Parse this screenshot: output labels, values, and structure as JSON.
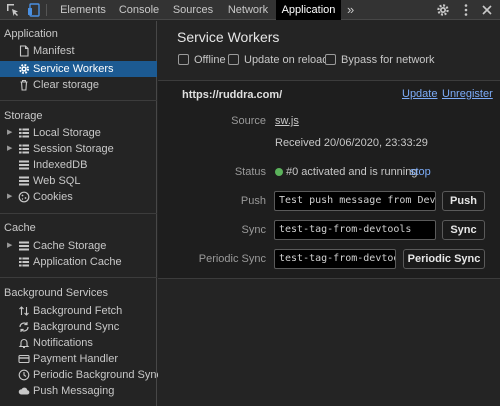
{
  "toolbar": {
    "tabs": [
      {
        "label": "Elements"
      },
      {
        "label": "Console"
      },
      {
        "label": "Sources"
      },
      {
        "label": "Network"
      },
      {
        "label": "Application"
      }
    ],
    "more_label": "»"
  },
  "sidebar": {
    "application": {
      "title": "Application",
      "items": [
        {
          "label": "Manifest"
        },
        {
          "label": "Service Workers"
        },
        {
          "label": "Clear storage"
        }
      ]
    },
    "storage": {
      "title": "Storage",
      "items": [
        {
          "label": "Local Storage"
        },
        {
          "label": "Session Storage"
        },
        {
          "label": "IndexedDB"
        },
        {
          "label": "Web SQL"
        },
        {
          "label": "Cookies"
        }
      ]
    },
    "cache": {
      "title": "Cache",
      "items": [
        {
          "label": "Cache Storage"
        },
        {
          "label": "Application Cache"
        }
      ]
    },
    "background": {
      "title": "Background Services",
      "items": [
        {
          "label": "Background Fetch"
        },
        {
          "label": "Background Sync"
        },
        {
          "label": "Notifications"
        },
        {
          "label": "Payment Handler"
        },
        {
          "label": "Periodic Background Sync"
        },
        {
          "label": "Push Messaging"
        }
      ]
    }
  },
  "main": {
    "title": "Service Workers",
    "options": {
      "offline": "Offline",
      "update_on_reload": "Update on reload",
      "bypass": "Bypass for network"
    },
    "worker": {
      "origin": "https://ruddra.com/",
      "update_link": "Update",
      "unregister_link": "Unregister",
      "source_label": "Source",
      "source_file": "sw.js",
      "received": "Received 20/06/2020, 23:33:29",
      "status_label": "Status",
      "status_text": "#0 activated and is running",
      "stop_link": "stop",
      "status_color": "#5bb25b",
      "push_label": "Push",
      "push_value": "Test push message from DevTools.",
      "push_button": "Push",
      "sync_label": "Sync",
      "sync_value": "test-tag-from-devtools",
      "sync_button": "Sync",
      "periodic_label": "Periodic Sync",
      "periodic_value": "test-tag-from-devtools",
      "periodic_button": "Periodic Sync"
    }
  },
  "colors": {
    "accent_selected": "#1c5a92",
    "link": "#7cacf8"
  }
}
